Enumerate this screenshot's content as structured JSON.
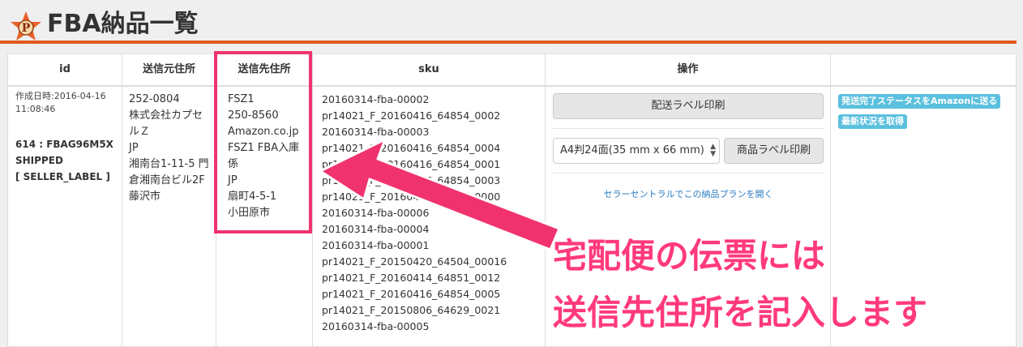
{
  "header": {
    "title": "FBA納品一覧",
    "logo_letter": "P"
  },
  "columns": [
    "id",
    "送信元住所",
    "送信先住所",
    "sku",
    "操作",
    ""
  ],
  "row": {
    "created_line1": "作成日時:2016-04-16",
    "created_line2": "11:08:46",
    "shipment_line1": "614 : FBAG96M5X",
    "shipment_line2": "SHIPPED",
    "shipment_line3": "[ SELLER_LABEL ]",
    "from_address": [
      "252-0804",
      "株式会社カプセ",
      "ルＺ",
      "JP",
      "湘南台1-11-5 門",
      "倉湘南台ビル2F",
      "藤沢市"
    ],
    "to_address": [
      "FSZ1",
      "250-8560",
      "Amazon.co.jp",
      "FSZ1 FBA入庫",
      "係",
      "JP",
      "扇町4-5-1",
      "小田原市"
    ],
    "skus": [
      "20160314-fba-00002",
      "pr14021_F_20160416_64854_0002",
      "20160314-fba-00003",
      "pr14021_F_20160416_64854_0004",
      "pr14021_F_20160416_64854_0001",
      "pr14021_F_20160416_64854_0003",
      "pr14021_F_20160416_64854_0000",
      "20160314-fba-00006",
      "20160314-fba-00004",
      "20160314-fba-00001",
      "pr14021_F_20150420_64504_00016",
      "pr14021_F_20160414_64851_0012",
      "pr14021_F_20160416_64854_0005",
      "pr14021_F_20150806_64629_0021",
      "20160314-fba-00005"
    ],
    "actions": {
      "shipping_label_btn": "配送ラベル印刷",
      "label_size_select": "A4判24面(35 mm x 66 mm)",
      "product_label_btn": "商品ラベル印刷",
      "seller_central_link": "セラーセントラルでこの納品プランを開く"
    },
    "extra_actions": {
      "send_status_btn": "発送完了ステータスをAmazonに送る",
      "refresh_status_btn": "最新状況を取得"
    }
  },
  "annotation": {
    "line1": "宅配便の伝票には",
    "line2": "送信先住所を記入します"
  },
  "colors": {
    "accent": "#e05a1a",
    "highlight": "#f0336e",
    "info": "#5bc0de",
    "link": "#2a7bc0"
  }
}
